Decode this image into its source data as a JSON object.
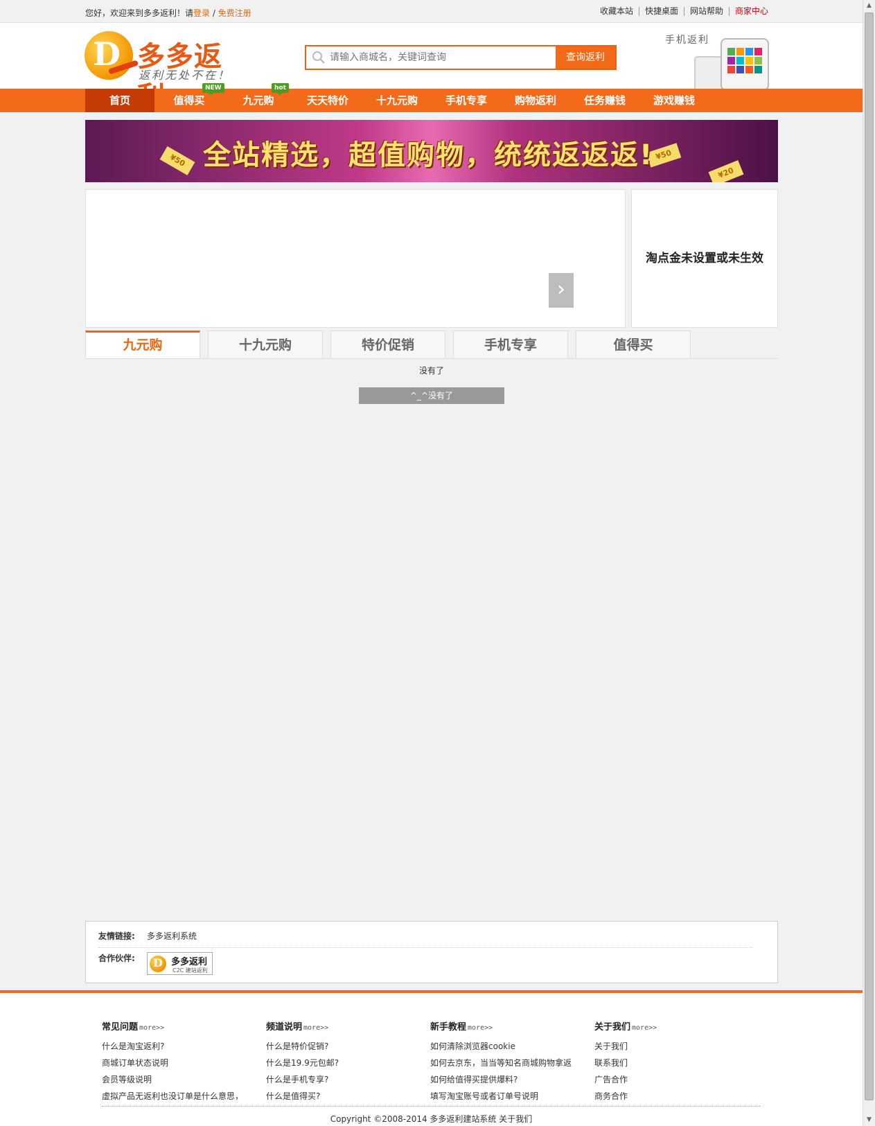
{
  "topbar": {
    "welcome": "您好，欢迎来到多多返利！请",
    "login": "登录",
    "slash": " / ",
    "register": "免费注册",
    "links": [
      "收藏本站",
      "快捷桌面",
      "网站帮助",
      "商家中心"
    ]
  },
  "header": {
    "logo_name": "多多返利",
    "logo_slogan": "返利无处不在！",
    "search_placeholder": "请输入商城名，关键词查询",
    "search_button": "查询返利",
    "mobile_label": "手机返利"
  },
  "nav": {
    "items": [
      "首页",
      "值得买",
      "九元购",
      "天天特价",
      "十九元购",
      "手机专享",
      "购物返利",
      "任务赚钱",
      "游戏赚钱"
    ],
    "badge_new": "NEW",
    "badge_hot": "hot"
  },
  "banner": {
    "text": "全站精选，超值购物，统统返返返!",
    "tags": [
      "¥50",
      "¥50",
      "¥20"
    ]
  },
  "side": {
    "text": "淘点金未设置或未生效"
  },
  "tabs": [
    "九元购",
    "十九元购",
    "特价促销",
    "手机专享",
    "值得买"
  ],
  "content": {
    "empty_text": "没有了",
    "empty_button": "^_^没有了"
  },
  "links": {
    "friend_label": "友情链接:",
    "friend_value": "多多返利系统",
    "partner_label": "合作伙伴:",
    "partner_name": "多多返利",
    "partner_sub": "C2C 建站返利"
  },
  "footer": {
    "more": "more>>",
    "columns": [
      {
        "title": "常见问题",
        "items": [
          "什么是淘宝返利?",
          "商城订单状态说明",
          "会员等级说明",
          "虚拟产品无返利也没订单是什么意思，"
        ]
      },
      {
        "title": "频道说明",
        "items": [
          "什么是特价促销?",
          "什么是19.9元包邮?",
          "什么是手机专享?",
          "什么是值得买?"
        ]
      },
      {
        "title": "新手教程",
        "items": [
          "如何清除浏览器cookie",
          "如何去京东，当当等知名商城购物拿返",
          "如何给值得买提供爆料?",
          "填写淘宝账号或者订单号说明"
        ]
      },
      {
        "title": "关于我们",
        "items": [
          "关于我们",
          "联系我们",
          "广告合作",
          "商务合作"
        ]
      }
    ],
    "copyright": "Copyright ©2008-2014  多多返利建站系统  关于我们"
  },
  "colors": {
    "brand_orange": "#f26a1a",
    "nav_active": "#c43b06",
    "link_orange": "#e8680f",
    "badge_green": "#4a9d1f"
  }
}
